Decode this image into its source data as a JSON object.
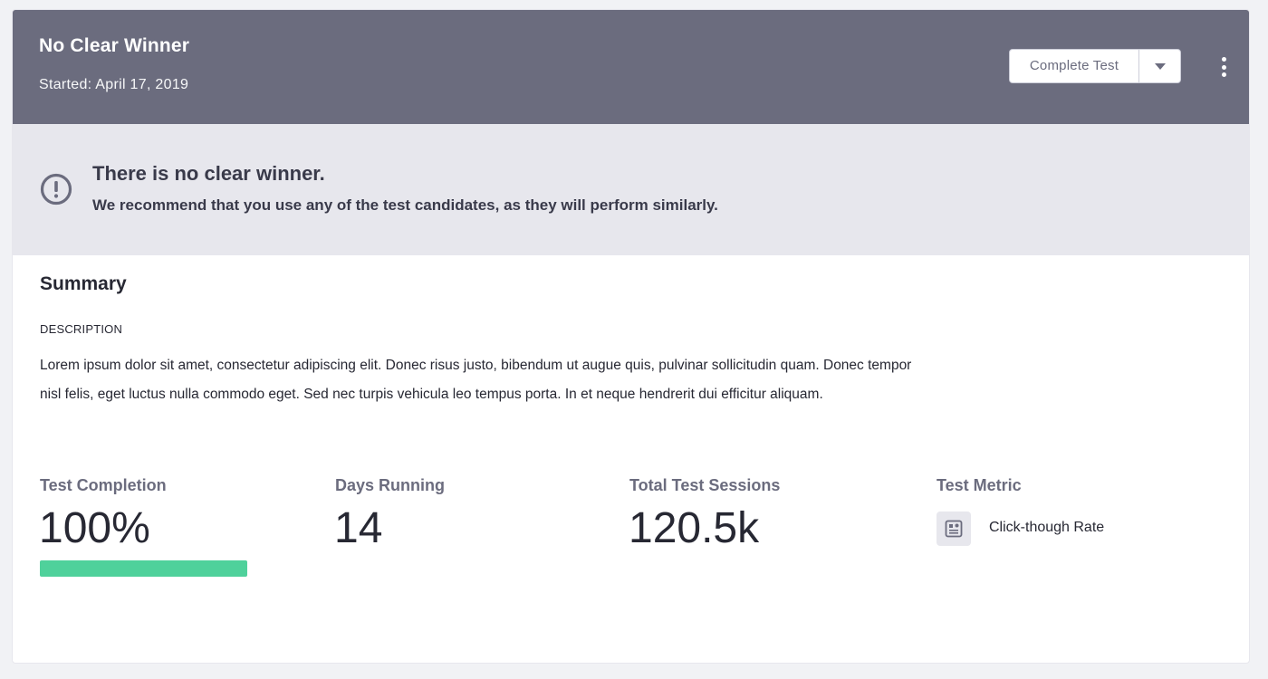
{
  "header": {
    "title": "No Clear Winner",
    "started": "Started: April 17, 2019",
    "complete_button": "Complete Test",
    "dropdown_icon": "caret-down-icon",
    "menu_icon": "vertical-ellipsis-icon"
  },
  "alert": {
    "icon": "exclamation-circle-icon",
    "title": "There is no clear winner.",
    "message": "We recommend that you use any of the test candidates, as they will perform similarly."
  },
  "summary": {
    "title": "Summary",
    "description_label": "DESCRIPTION",
    "description": "Lorem ipsum dolor sit amet, consectetur adipiscing elit. Donec risus justo, bibendum ut augue quis, pulvinar sollicitudin quam. Donec tempor nisl felis, eget luctus nulla commodo eget. Sed nec turpis vehicula leo tempus porta. In et neque hendrerit dui efficitur aliquam."
  },
  "metrics": {
    "completion": {
      "label": "Test Completion",
      "value": "100%",
      "progress_percent": 100
    },
    "days": {
      "label": "Days Running",
      "value": "14"
    },
    "sessions": {
      "label": "Total Test Sessions",
      "value": "120.5k"
    },
    "test_metric": {
      "label": "Test Metric",
      "icon": "metric-card-icon",
      "name": "Click-though Rate"
    }
  },
  "colors": {
    "header_bg": "#6b6c7e",
    "alert_bg": "#e7e7ed",
    "progress_fill": "#4fd19b",
    "text_dark": "#272833",
    "text_muted": "#6b6c7e"
  }
}
